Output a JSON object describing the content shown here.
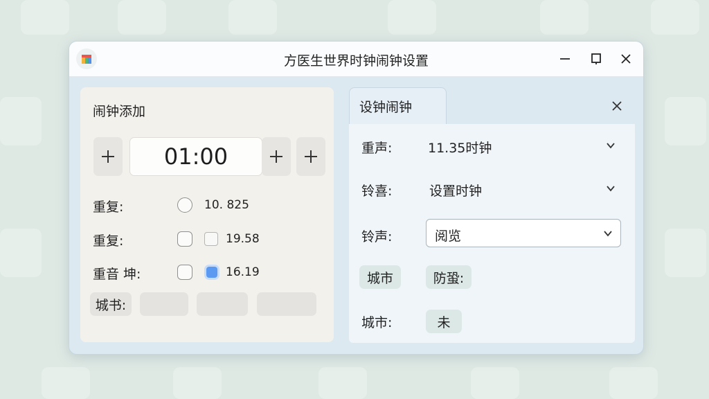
{
  "window": {
    "title": "方医生世界时钟闹钟设置"
  },
  "left_panel": {
    "heading": "闹钟添加",
    "time_value": "01:00",
    "rows": [
      {
        "label": "重复:",
        "value": "10. 825",
        "checked": false
      },
      {
        "label": "重复:",
        "value": "19.58",
        "checked": false
      },
      {
        "label": "重音 坤:",
        "value": "16.19",
        "checked": true
      }
    ],
    "city_chip": "城书:"
  },
  "right_panel": {
    "tab_label": "设钟闹钟",
    "rows": [
      {
        "label": "重声:",
        "value": "11.35时钟"
      },
      {
        "label": "铃喜:",
        "value": "设置时钟"
      },
      {
        "label": "铃声:",
        "value": "阅览"
      }
    ],
    "chip_city": "城市",
    "chip_other": "防蛩:",
    "city_label": "城市:",
    "city_value": "未"
  },
  "colors": {
    "accent": "#5b9af0",
    "window_bg": "#dce9f1",
    "left_panel_bg": "#f3f1ec",
    "right_panel_bg": "#f0f5f9"
  }
}
